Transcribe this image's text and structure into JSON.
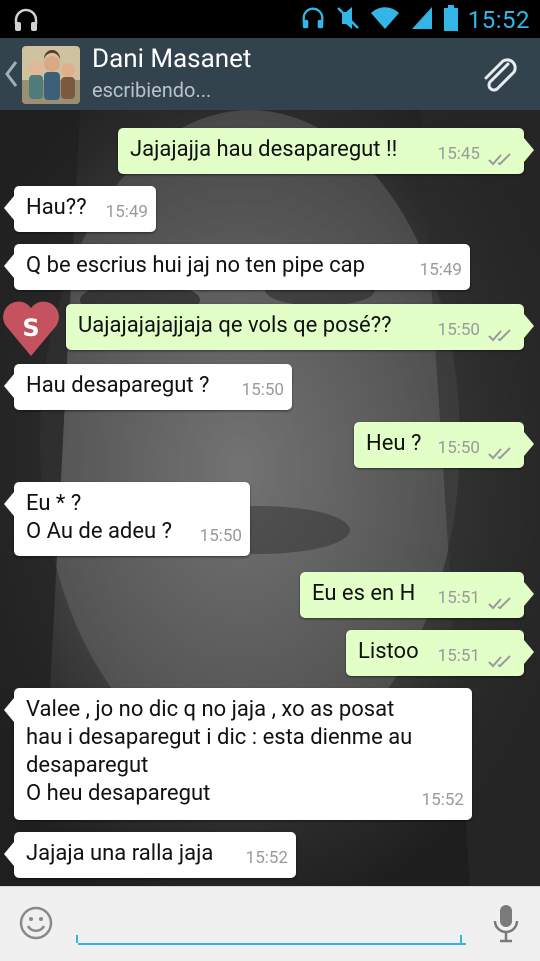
{
  "status_bar": {
    "time": "15:52",
    "icons": [
      "headphones-icon",
      "headphones-icon",
      "mute-icon",
      "wifi-icon",
      "signal-icon",
      "battery-icon"
    ]
  },
  "header": {
    "contact_name": "Dani Masanet",
    "contact_status": "escribiendo...",
    "icons": [
      "back-chevron-icon",
      "avatar-photo",
      "paperclip-icon"
    ]
  },
  "messages": [
    {
      "dir": "out",
      "text": "Jajajajja hau desaparegut !!",
      "time": "15:45",
      "ticks": true
    },
    {
      "dir": "in",
      "text": "Hau??",
      "time": "15:49"
    },
    {
      "dir": "in",
      "text": "Q be escrius hui jaj no ten pipe cap",
      "time": "15:49"
    },
    {
      "dir": "out",
      "text": "Uajajajajajjaja qe vols qe posé??",
      "time": "15:50",
      "ticks": true
    },
    {
      "dir": "in",
      "text": "Hau desaparegut ?",
      "time": "15:50"
    },
    {
      "dir": "out",
      "text": "Heu ?",
      "time": "15:50",
      "ticks": true
    },
    {
      "dir": "in",
      "text": "Eu * ?\nO Au de adeu ?",
      "time": "15:50"
    },
    {
      "dir": "out",
      "text": "Eu es en H",
      "time": "15:51",
      "ticks": true
    },
    {
      "dir": "out",
      "text": "Listoo",
      "time": "15:51",
      "ticks": true
    },
    {
      "dir": "in",
      "text": "Valee , jo no dic q no jaja , xo as posat\nhau i desaparegut i dic : esta dienme au\ndesaparegut\nO heu desaparegut",
      "time": "15:52"
    },
    {
      "dir": "in",
      "text": "Jajaja una ralla jaja",
      "time": "15:52"
    }
  ],
  "watermark": {
    "letter": "S",
    "color": "#e05a6a"
  },
  "input": {
    "value": "",
    "placeholder": "",
    "icons": [
      "emoji-icon",
      "microphone-icon"
    ]
  },
  "colors": {
    "accent": "#33b5e5",
    "header_bg": "#32434d",
    "outgoing_bubble": "#e2ffc8",
    "incoming_bubble": "#ffffff"
  }
}
